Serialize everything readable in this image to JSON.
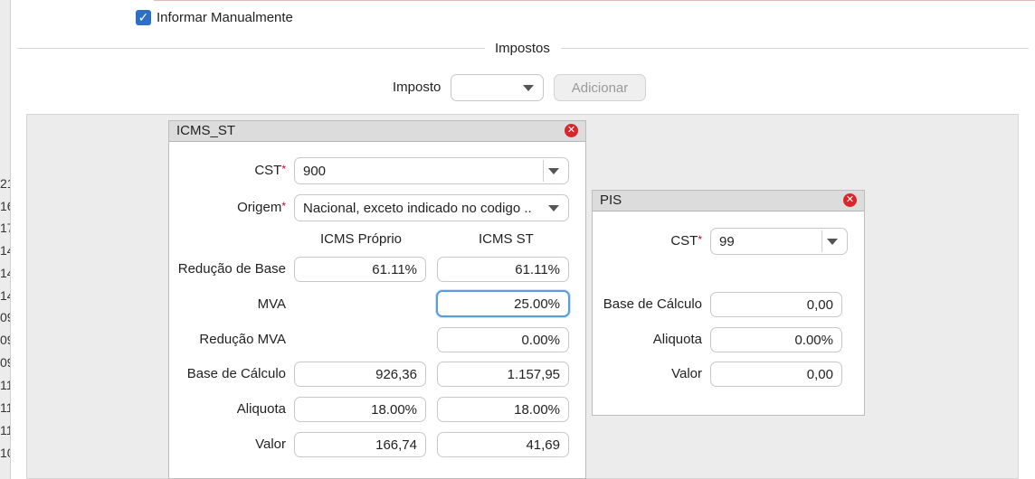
{
  "left_strip_numbers": [
    "21",
    "16",
    "17",
    "14",
    "14",
    "14",
    "09",
    "09",
    "09",
    "11",
    "11",
    "11",
    "10"
  ],
  "manual": {
    "checkbox_checked": true,
    "label": "Informar Manualmente"
  },
  "taxes_section": {
    "title": "Impostos",
    "imposto_label": "Imposto",
    "imposto_value": "",
    "add_button": "Adicionar"
  },
  "icms_panel": {
    "title": "ICMS_ST",
    "cst_label": "CST",
    "cst_value": "900",
    "origem_label": "Origem",
    "origem_value": "Nacional, exceto indicado no codigo ...",
    "required_mark": "*",
    "col_proprio": "ICMS Próprio",
    "col_st": "ICMS ST",
    "rows": {
      "reducao_base": {
        "label": "Redução de Base",
        "proprio": "61.11%",
        "st": "61.11%"
      },
      "mva": {
        "label": "MVA",
        "st": "25.00%"
      },
      "reducao_mva": {
        "label": "Redução MVA",
        "st": "0.00%"
      },
      "base_calculo": {
        "label": "Base de Cálculo",
        "proprio": "926,36",
        "st": "1.157,95"
      },
      "aliquota": {
        "label": "Aliquota",
        "proprio": "18.00%",
        "st": "18.00%"
      },
      "valor": {
        "label": "Valor",
        "proprio": "166,74",
        "st": "41,69"
      }
    }
  },
  "pis_panel": {
    "title": "PIS",
    "cst_label": "CST",
    "cst_value": "99",
    "required_mark": "*",
    "base_calculo_label": "Base de Cálculo",
    "base_calculo_value": "0,00",
    "aliquota_label": "Aliquota",
    "aliquota_value": "0.00%",
    "valor_label": "Valor",
    "valor_value": "0,00"
  },
  "colors": {
    "accent": "#2d6fc4",
    "close": "#d9262c",
    "required": "#d0021b",
    "focus": "#5b9be0"
  }
}
